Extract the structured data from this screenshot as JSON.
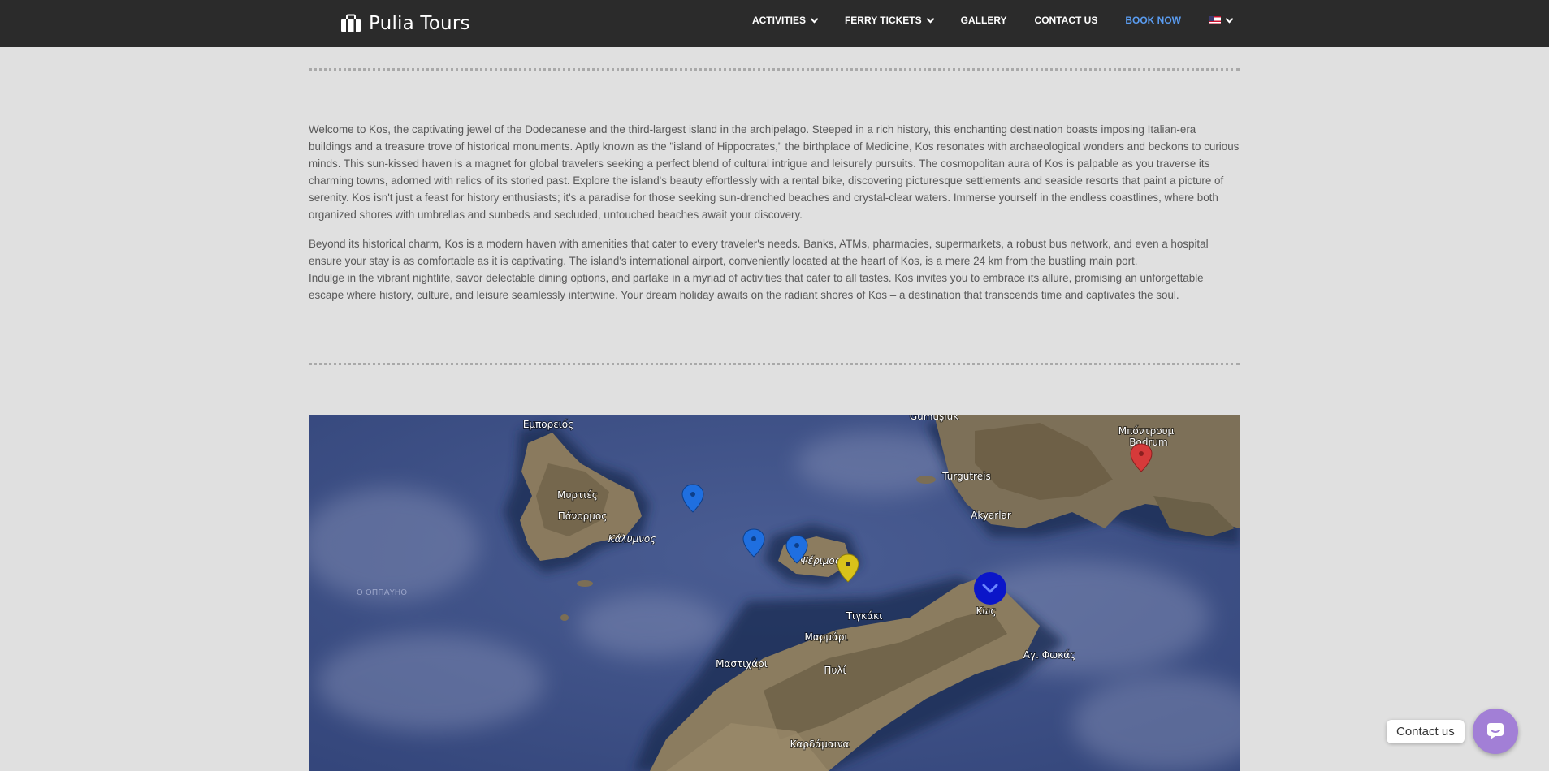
{
  "nav": {
    "logo_text": "Pulia Tours",
    "items": [
      {
        "label": "ACTIVITIES",
        "has_dropdown": true
      },
      {
        "label": "FERRY TICKETS",
        "has_dropdown": true
      },
      {
        "label": "GALLERY",
        "has_dropdown": false
      },
      {
        "label": "CONTACT US",
        "has_dropdown": false
      },
      {
        "label": "BOOK NOW",
        "has_dropdown": false,
        "accent": "#5a9cf0"
      }
    ],
    "language_icon": "us-flag-icon"
  },
  "intro": {
    "paragraphs": [
      "Welcome to Kos, the captivating jewel of the Dodecanese and the third-largest island in the archipelago. Steeped in a rich history, this enchanting destination boasts imposing Italian-era buildings and a treasure trove of historical monuments. Aptly known as the \"island of Hippocrates,\" the birthplace of Medicine, Kos resonates with archaeological wonders and beckons to curious minds. This sun-kissed haven is a magnet for global travelers seeking a perfect blend of cultural intrigue and leisurely pursuits. The cosmopolitan aura of Kos is palpable as you traverse its charming towns, adorned with relics of its storied past. Explore the island's beauty effortlessly with a rental bike, discovering picturesque settlements and seaside resorts that paint a picture of serenity. Kos isn't just a feast for history enthusiasts; it's a paradise for those seeking sun-drenched beaches and crystal-clear waters. Immerse yourself in the endless coastlines, where both organized shores with umbrellas and sunbeds and secluded, untouched beaches await your discovery.",
      "Beyond its historical charm, Kos is a modern haven with amenities that cater to every traveler's needs. Banks, ATMs, pharmacies, supermarkets, a robust bus network, and even a hospital ensure your stay is as comfortable as it is captivating. The island's international airport, conveniently located at the heart of Kos, is a mere 24 km from the bustling main port.",
      "Indulge in the vibrant nightlife, savor delectable dining options, and partake in a myriad of activities that cater to all tastes. Kos invites you to embrace its allure, promising an unforgettable escape where history, culture, and leisure seamlessly intertwine. Your dream holiday awaits on the radiant shores of Kos – a destination that transcends time and captivates the soul."
    ]
  },
  "map": {
    "labels": {
      "emporeios": "Εμπορειός",
      "myrties": "Μυρτιές",
      "panormos": "Πάνορμος",
      "kalymnos": "Κάλυμνος",
      "gumusluk": "Gümüşlük",
      "bodrum_gr": "Μπόντρουμ",
      "bodrum": "Bodrum",
      "turgutreis": "Turgutreis",
      "akyarlar": "Akyarlar",
      "pserimos": "Ψέριμος",
      "tigaki": "Τιγκάκι",
      "kos": "Κως",
      "marmari": "Μαρμάρι",
      "ag_fokas": "Αγ. Φωκάς",
      "mastichari": "Μαστιχάρι",
      "pyli": "Πυλί",
      "kardamena": "Καρδάμαινα",
      "ocean_mark": "Ο ΟΠΠΑΥΗΟ"
    },
    "markers": [
      {
        "color": "#1f6fe0",
        "name": "blue"
      },
      {
        "color": "#1f6fe0",
        "name": "blue"
      },
      {
        "color": "#1f6fe0",
        "name": "blue"
      },
      {
        "color": "#d9c21a",
        "name": "yellow"
      },
      {
        "color": "#d63a3a",
        "name": "red"
      },
      {
        "color": "#0b16c9",
        "name": "current-location"
      }
    ]
  },
  "contact": {
    "label": "Contact us"
  }
}
